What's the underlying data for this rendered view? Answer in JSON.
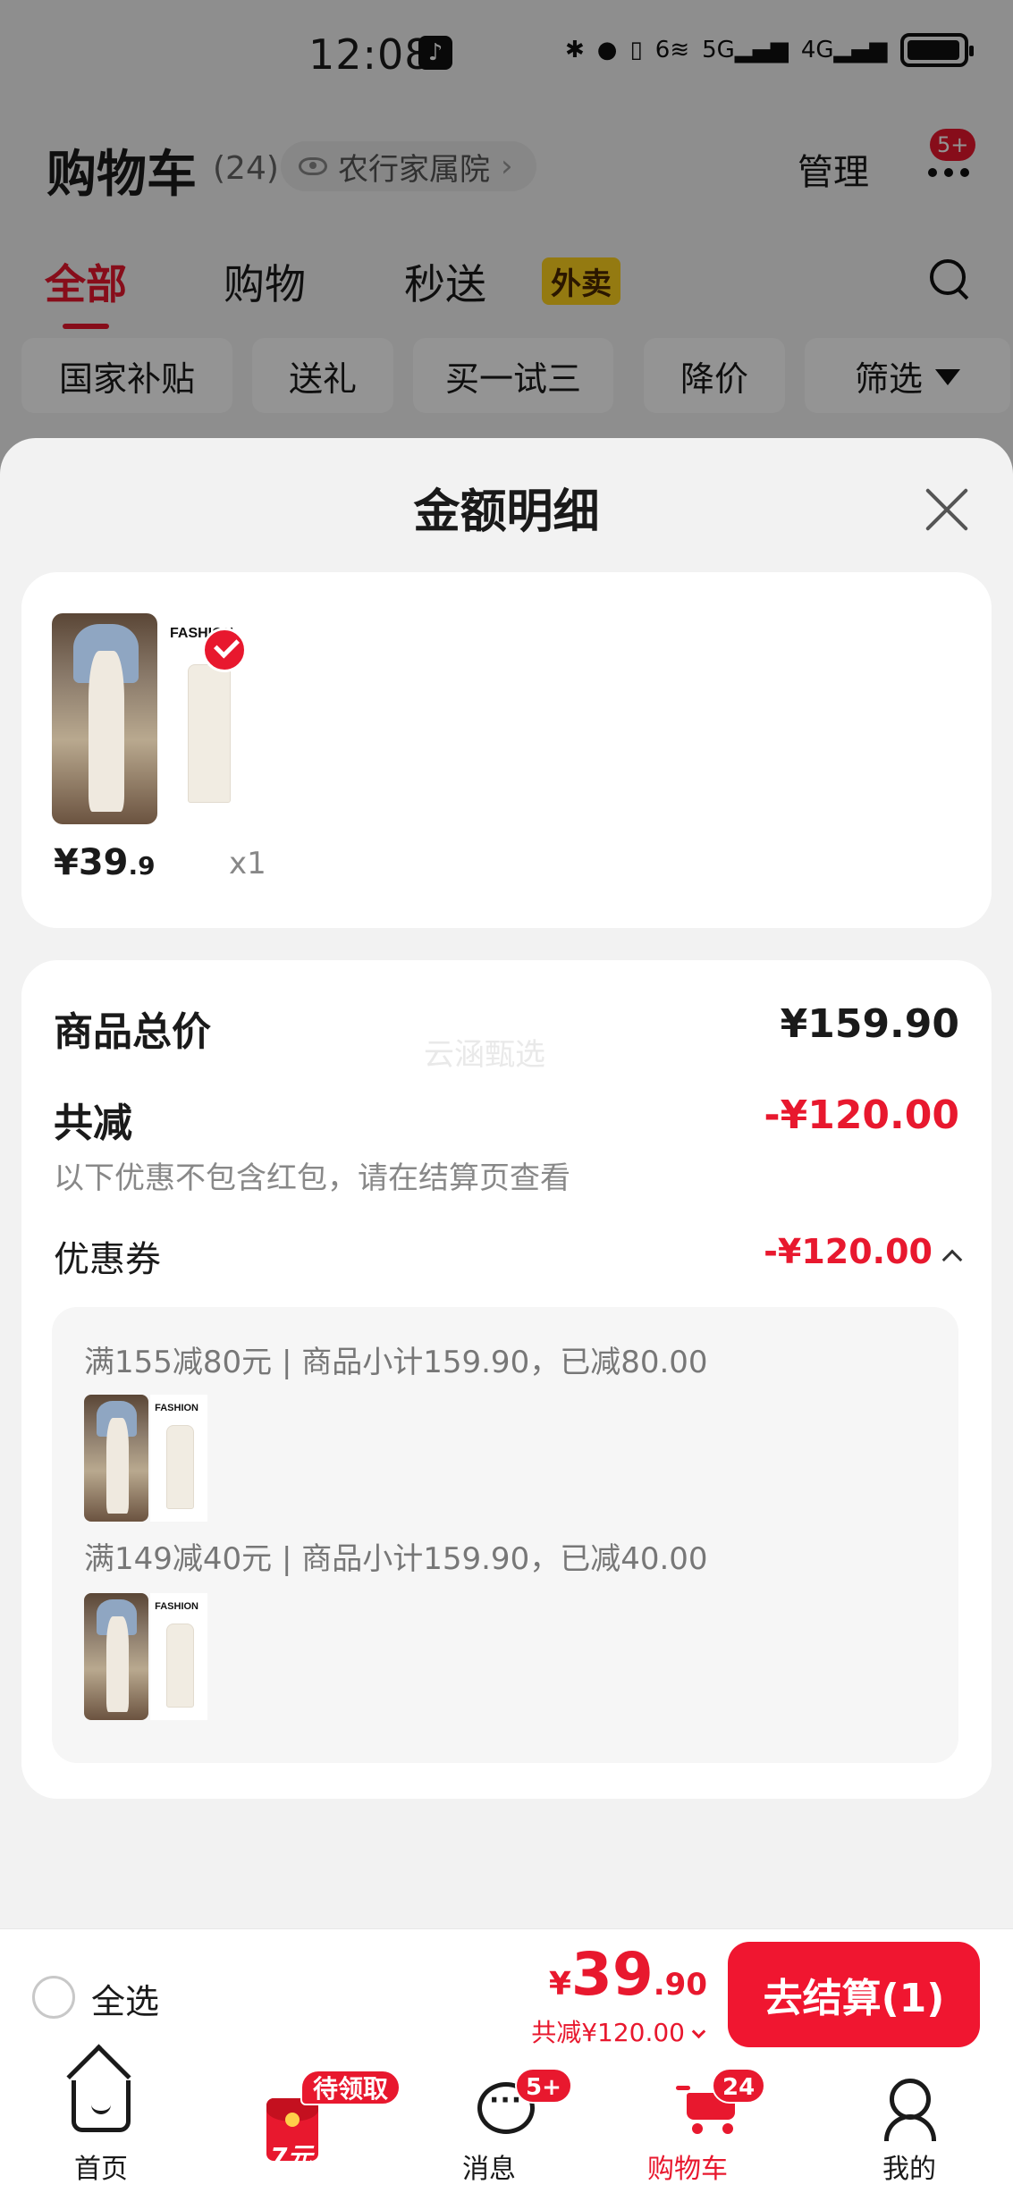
{
  "status_bar": {
    "time": "12:08",
    "network_5g": "5G",
    "network_4g": "4G",
    "network_6": "6"
  },
  "header": {
    "title": "购物车",
    "count": "(24)",
    "address": "农行家属院",
    "manage": "管理",
    "more_badge": "5+"
  },
  "tabs": [
    {
      "label": "全部"
    },
    {
      "label": "购物"
    },
    {
      "label": "秒送",
      "badge": "外卖"
    }
  ],
  "filters": [
    {
      "label": "国家补贴"
    },
    {
      "label": "送礼"
    },
    {
      "label": "买一试三"
    },
    {
      "label": "降价"
    },
    {
      "label": "筛选"
    }
  ],
  "sheet": {
    "title": "金额明细",
    "product": {
      "price_main": "¥39",
      "price_decimal": ".9",
      "qty": "x1",
      "image_text": "FASHION"
    },
    "summary": {
      "total_label": "商品总价",
      "total_value": "¥159.90",
      "discount_label": "共减",
      "discount_value": "-¥120.00",
      "discount_note": "以下优惠不包含红包，请在结算页查看",
      "coupon_label": "优惠券",
      "coupon_value": "-¥120.00",
      "watermark": "云涵甄选"
    },
    "coupons": [
      {
        "text": "满155减80元 | 商品小计159.90，已减80.00"
      },
      {
        "text": "满149减40元 | 商品小计159.90，已减40.00"
      }
    ]
  },
  "checkout": {
    "select_all": "全选",
    "currency": "¥",
    "price_int": "39",
    "price_dec": ".90",
    "discount": "共减¥120.00",
    "button": "去结算(1)"
  },
  "nav": [
    {
      "label": "首页"
    },
    {
      "label": "",
      "tag": "待领取",
      "amount": "7元"
    },
    {
      "label": "消息",
      "badge": "5+"
    },
    {
      "label": "购物车",
      "badge": "24"
    },
    {
      "label": "我的"
    }
  ]
}
